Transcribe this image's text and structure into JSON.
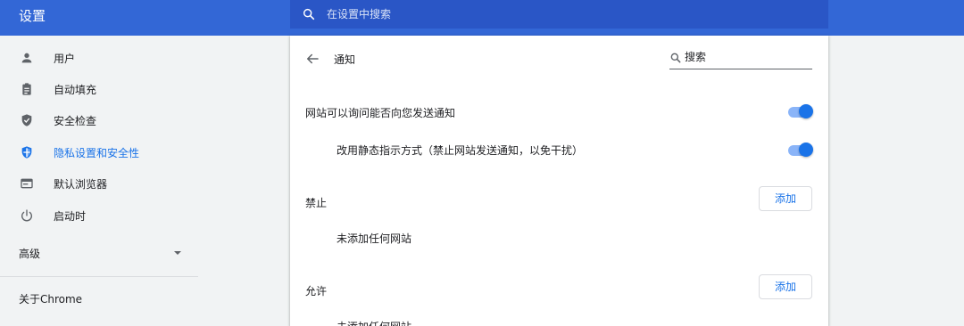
{
  "app": {
    "title": "设置"
  },
  "search": {
    "placeholder": "在设置中搜索"
  },
  "sidebar": {
    "items": [
      {
        "label": "用户",
        "icon": "person-icon"
      },
      {
        "label": "自动填充",
        "icon": "clipboard-icon"
      },
      {
        "label": "安全检查",
        "icon": "shield-check-icon"
      },
      {
        "label": "隐私设置和安全性",
        "icon": "shield-privacy-icon",
        "active": true
      },
      {
        "label": "默认浏览器",
        "icon": "browser-window-icon"
      },
      {
        "label": "启动时",
        "icon": "power-icon"
      }
    ],
    "advanced_label": "高级",
    "about_label": "关于Chrome"
  },
  "page": {
    "title": "通知",
    "search_placeholder": "搜索",
    "ask_label": "网站可以询问能否向您发送通知",
    "ask_enabled": true,
    "quiet_label": "改用静态指示方式（禁止网站发送通知，以免干扰）",
    "quiet_enabled": true,
    "block": {
      "label": "禁止",
      "add_label": "添加",
      "empty": "未添加任何网站"
    },
    "allow": {
      "label": "允许",
      "add_label": "添加",
      "empty": "未添加任何网站"
    }
  },
  "colors": {
    "accent": "#1a73e8",
    "header": "#3367d6",
    "search_bar": "#2a56c6"
  }
}
